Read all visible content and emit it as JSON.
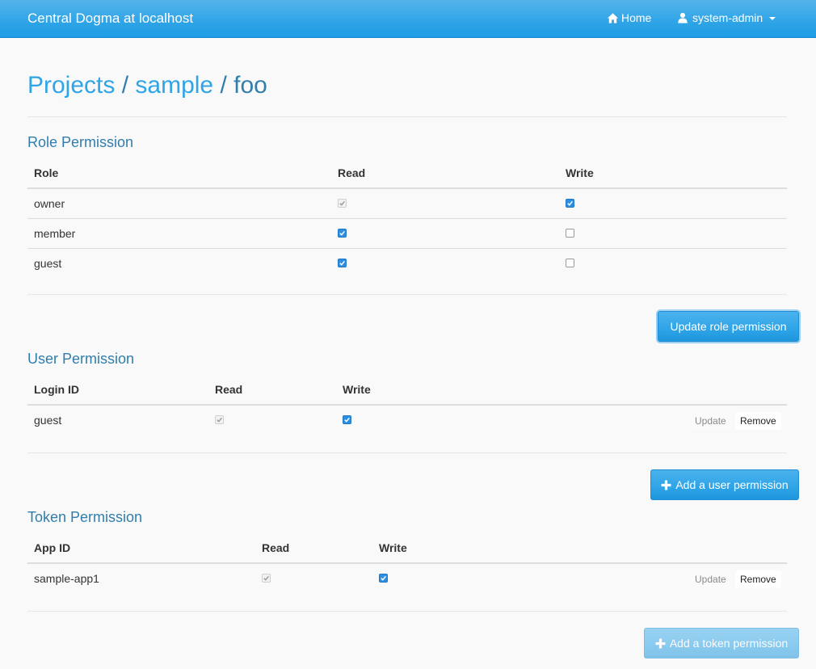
{
  "navbar": {
    "brand": "Central Dogma at localhost",
    "home_label": "Home",
    "user_label": "system-admin"
  },
  "breadcrumb": {
    "projects": "Projects",
    "separator": "/",
    "project": "sample",
    "repo": "foo"
  },
  "role_permission": {
    "title": "Role Permission",
    "headers": [
      "Role",
      "Read",
      "Write"
    ],
    "rows": [
      {
        "role": "owner",
        "read": "checked-disabled",
        "write": "checked"
      },
      {
        "role": "member",
        "read": "checked",
        "write": "unchecked"
      },
      {
        "role": "guest",
        "read": "checked",
        "write": "unchecked"
      }
    ],
    "update_button": "Update role permission"
  },
  "user_permission": {
    "title": "User Permission",
    "headers": [
      "Login ID",
      "Read",
      "Write"
    ],
    "rows": [
      {
        "login_id": "guest",
        "read": "checked-disabled",
        "write": "checked",
        "update": "Update",
        "remove": "Remove"
      }
    ],
    "add_button": "Add a user permission"
  },
  "token_permission": {
    "title": "Token Permission",
    "headers": [
      "App ID",
      "Read",
      "Write"
    ],
    "rows": [
      {
        "app_id": "sample-app1",
        "read": "checked-disabled",
        "write": "checked",
        "update": "Update",
        "remove": "Remove"
      }
    ],
    "add_button": "Add a token permission"
  },
  "colors": {
    "navbar": "#2fa4e7",
    "heading": "#317eac",
    "link": "#2fa4e7",
    "checkbox_on": "#2e8ee0"
  }
}
